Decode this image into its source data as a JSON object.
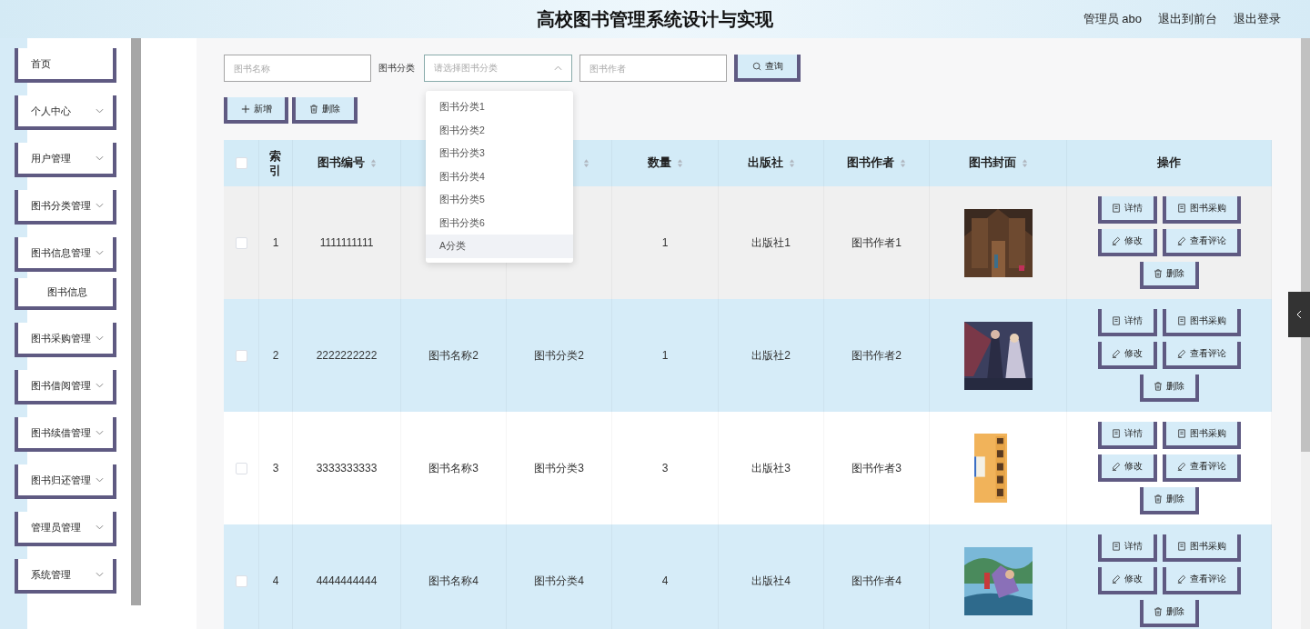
{
  "header": {
    "title": "高校图书管理系统设计与实现",
    "user": "管理员 abo",
    "links": [
      "退出到前台",
      "退出登录"
    ]
  },
  "sidebar": {
    "items": [
      {
        "label": "首页",
        "kind": "link"
      },
      {
        "label": "个人中心",
        "kind": "group"
      },
      {
        "label": "用户管理",
        "kind": "group"
      },
      {
        "label": "图书分类管理",
        "kind": "group"
      },
      {
        "label": "图书信息管理",
        "kind": "group"
      },
      {
        "label": "图书信息",
        "kind": "sub"
      },
      {
        "label": "图书采购管理",
        "kind": "group"
      },
      {
        "label": "图书借阅管理",
        "kind": "group"
      },
      {
        "label": "图书续借管理",
        "kind": "group"
      },
      {
        "label": "图书归还管理",
        "kind": "group"
      },
      {
        "label": "管理员管理",
        "kind": "group"
      },
      {
        "label": "系统管理",
        "kind": "group"
      }
    ]
  },
  "search": {
    "name_field": {
      "placeholder": "图书名称"
    },
    "category_label": "图书分类",
    "category_select": {
      "placeholder": "请选择图书分类",
      "expanded": true
    },
    "author_field": {
      "placeholder": "图书作者"
    },
    "query_button": "查询"
  },
  "dropdown": {
    "options": [
      {
        "label": "图书分类1",
        "hovered": false
      },
      {
        "label": "图书分类2",
        "hovered": false
      },
      {
        "label": "图书分类3",
        "hovered": false
      },
      {
        "label": "图书分类4",
        "hovered": false
      },
      {
        "label": "图书分类5",
        "hovered": false
      },
      {
        "label": "图书分类6",
        "hovered": false
      },
      {
        "label": "A分类",
        "hovered": true
      }
    ]
  },
  "toolbar": [
    "新增",
    "删除"
  ],
  "table": {
    "select_all": {
      "checked": false
    },
    "columns": [
      {
        "label": "索引",
        "sortable": false
      },
      {
        "label": "图书编号",
        "sortable": true
      },
      {},
      {
        "sortable": true
      },
      {
        "label": "数量",
        "sortable": true
      },
      {
        "label": "出版社",
        "sortable": true
      },
      {
        "label": "图书作者",
        "sortable": true
      },
      {
        "label": "图书封面",
        "sortable": true
      },
      {
        "label": "操作",
        "sortable": false
      }
    ],
    "rows": [
      {
        "checked": false,
        "hovered": true,
        "cells": [
          "1",
          "1111111111",
          null,
          null,
          "1",
          "出版社1",
          "图书作者1"
        ],
        "actions": [
          "详情",
          "图书采购",
          "修改",
          "查看评论",
          "删除"
        ]
      },
      {
        "checked": false,
        "hovered": false,
        "cells": [
          "2",
          "2222222222",
          "图书名称2",
          "图书分类2",
          "1",
          "出版社2",
          "图书作者2"
        ],
        "actions": [
          "详情",
          "图书采购",
          "修改",
          "查看评论",
          "删除"
        ]
      },
      {
        "checked": false,
        "hovered": false,
        "cells": [
          "3",
          "3333333333",
          "图书名称3",
          "图书分类3",
          "3",
          "出版社3",
          "图书作者3"
        ],
        "actions": [
          "详情",
          "图书采购",
          "修改",
          "查看评论",
          "删除"
        ]
      },
      {
        "checked": false,
        "hovered": false,
        "cells": [
          "4",
          "4444444444",
          "图书名称4",
          "图书分类4",
          "4",
          "出版社4",
          "图书作者4"
        ],
        "actions": [
          "详情",
          "图书采购",
          "修改",
          "查看评论",
          "删除"
        ]
      }
    ]
  }
}
